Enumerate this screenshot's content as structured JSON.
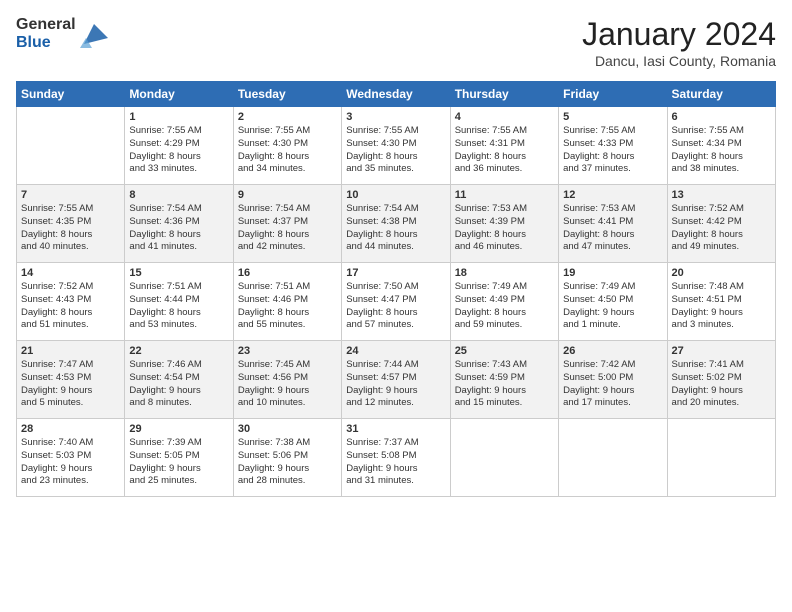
{
  "header": {
    "logo_general": "General",
    "logo_blue": "Blue",
    "month_title": "January 2024",
    "location": "Dancu, Iasi County, Romania"
  },
  "days_of_week": [
    "Sunday",
    "Monday",
    "Tuesday",
    "Wednesday",
    "Thursday",
    "Friday",
    "Saturday"
  ],
  "weeks": [
    [
      {
        "day": "",
        "info": ""
      },
      {
        "day": "1",
        "info": "Sunrise: 7:55 AM\nSunset: 4:29 PM\nDaylight: 8 hours\nand 33 minutes."
      },
      {
        "day": "2",
        "info": "Sunrise: 7:55 AM\nSunset: 4:30 PM\nDaylight: 8 hours\nand 34 minutes."
      },
      {
        "day": "3",
        "info": "Sunrise: 7:55 AM\nSunset: 4:30 PM\nDaylight: 8 hours\nand 35 minutes."
      },
      {
        "day": "4",
        "info": "Sunrise: 7:55 AM\nSunset: 4:31 PM\nDaylight: 8 hours\nand 36 minutes."
      },
      {
        "day": "5",
        "info": "Sunrise: 7:55 AM\nSunset: 4:33 PM\nDaylight: 8 hours\nand 37 minutes."
      },
      {
        "day": "6",
        "info": "Sunrise: 7:55 AM\nSunset: 4:34 PM\nDaylight: 8 hours\nand 38 minutes."
      }
    ],
    [
      {
        "day": "7",
        "info": "Sunrise: 7:55 AM\nSunset: 4:35 PM\nDaylight: 8 hours\nand 40 minutes."
      },
      {
        "day": "8",
        "info": "Sunrise: 7:54 AM\nSunset: 4:36 PM\nDaylight: 8 hours\nand 41 minutes."
      },
      {
        "day": "9",
        "info": "Sunrise: 7:54 AM\nSunset: 4:37 PM\nDaylight: 8 hours\nand 42 minutes."
      },
      {
        "day": "10",
        "info": "Sunrise: 7:54 AM\nSunset: 4:38 PM\nDaylight: 8 hours\nand 44 minutes."
      },
      {
        "day": "11",
        "info": "Sunrise: 7:53 AM\nSunset: 4:39 PM\nDaylight: 8 hours\nand 46 minutes."
      },
      {
        "day": "12",
        "info": "Sunrise: 7:53 AM\nSunset: 4:41 PM\nDaylight: 8 hours\nand 47 minutes."
      },
      {
        "day": "13",
        "info": "Sunrise: 7:52 AM\nSunset: 4:42 PM\nDaylight: 8 hours\nand 49 minutes."
      }
    ],
    [
      {
        "day": "14",
        "info": "Sunrise: 7:52 AM\nSunset: 4:43 PM\nDaylight: 8 hours\nand 51 minutes."
      },
      {
        "day": "15",
        "info": "Sunrise: 7:51 AM\nSunset: 4:44 PM\nDaylight: 8 hours\nand 53 minutes."
      },
      {
        "day": "16",
        "info": "Sunrise: 7:51 AM\nSunset: 4:46 PM\nDaylight: 8 hours\nand 55 minutes."
      },
      {
        "day": "17",
        "info": "Sunrise: 7:50 AM\nSunset: 4:47 PM\nDaylight: 8 hours\nand 57 minutes."
      },
      {
        "day": "18",
        "info": "Sunrise: 7:49 AM\nSunset: 4:49 PM\nDaylight: 8 hours\nand 59 minutes."
      },
      {
        "day": "19",
        "info": "Sunrise: 7:49 AM\nSunset: 4:50 PM\nDaylight: 9 hours\nand 1 minute."
      },
      {
        "day": "20",
        "info": "Sunrise: 7:48 AM\nSunset: 4:51 PM\nDaylight: 9 hours\nand 3 minutes."
      }
    ],
    [
      {
        "day": "21",
        "info": "Sunrise: 7:47 AM\nSunset: 4:53 PM\nDaylight: 9 hours\nand 5 minutes."
      },
      {
        "day": "22",
        "info": "Sunrise: 7:46 AM\nSunset: 4:54 PM\nDaylight: 9 hours\nand 8 minutes."
      },
      {
        "day": "23",
        "info": "Sunrise: 7:45 AM\nSunset: 4:56 PM\nDaylight: 9 hours\nand 10 minutes."
      },
      {
        "day": "24",
        "info": "Sunrise: 7:44 AM\nSunset: 4:57 PM\nDaylight: 9 hours\nand 12 minutes."
      },
      {
        "day": "25",
        "info": "Sunrise: 7:43 AM\nSunset: 4:59 PM\nDaylight: 9 hours\nand 15 minutes."
      },
      {
        "day": "26",
        "info": "Sunrise: 7:42 AM\nSunset: 5:00 PM\nDaylight: 9 hours\nand 17 minutes."
      },
      {
        "day": "27",
        "info": "Sunrise: 7:41 AM\nSunset: 5:02 PM\nDaylight: 9 hours\nand 20 minutes."
      }
    ],
    [
      {
        "day": "28",
        "info": "Sunrise: 7:40 AM\nSunset: 5:03 PM\nDaylight: 9 hours\nand 23 minutes."
      },
      {
        "day": "29",
        "info": "Sunrise: 7:39 AM\nSunset: 5:05 PM\nDaylight: 9 hours\nand 25 minutes."
      },
      {
        "day": "30",
        "info": "Sunrise: 7:38 AM\nSunset: 5:06 PM\nDaylight: 9 hours\nand 28 minutes."
      },
      {
        "day": "31",
        "info": "Sunrise: 7:37 AM\nSunset: 5:08 PM\nDaylight: 9 hours\nand 31 minutes."
      },
      {
        "day": "",
        "info": ""
      },
      {
        "day": "",
        "info": ""
      },
      {
        "day": "",
        "info": ""
      }
    ]
  ]
}
